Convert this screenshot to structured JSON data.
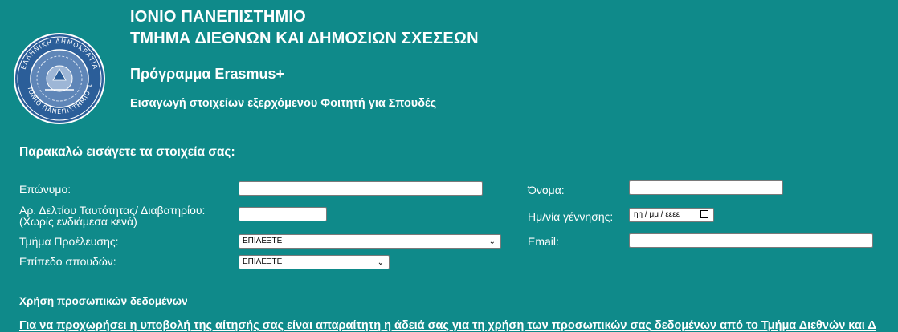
{
  "header": {
    "university": "ΙΟΝΙΟ ΠΑΝΕΠΙΣΤΗΜΙΟ",
    "department": "ΤΜΗΜΑ ΔΙΕΘΝΩΝ ΚΑΙ ΔΗΜΟΣΙΩΝ ΣΧΕΣΕΩΝ",
    "program": "Πρόγραμμα Erasmus+",
    "subtitle": "Εισαγωγή στοιχείων εξερχόμενου Φοιτητή για Σπουδές",
    "seal_icon": "university-seal-icon"
  },
  "form": {
    "intro": "Παρακαλώ εισάγετε τα στοιχεία σας:",
    "surname_label": "Επώνυμο:",
    "id_label_line1": "Αρ. Δελτίου Ταυτότητας/ Διαβατηρίου:",
    "id_label_line2": "(Χωρίς ενδιάμεσα κενά)",
    "department_label": "Τμήμα Προέλευσης:",
    "department_value": "ΕΠΙΛΕΞΤΕ",
    "level_label": "Επίπεδο σπουδών:",
    "level_value": "ΕΠΙΛΕΞΤΕ",
    "name_label": "Όνομα:",
    "dob_label": "Ημ/νία γέννησης:",
    "dob_placeholder": "ηη / μμ / εεεε",
    "email_label": "Email:"
  },
  "privacy": {
    "title": "Χρήση προσωπικών δεδομένων",
    "text": "Για να προχωρήσει η υποβολή της αίτησής σας είναι απαραίτητη η άδειά σας για τη χρήση των προσωπικών σας δεδομένων από το Τμήμα Διεθνών και Δ"
  },
  "colors": {
    "background": "#0f8a8a",
    "text": "#ffffff"
  }
}
